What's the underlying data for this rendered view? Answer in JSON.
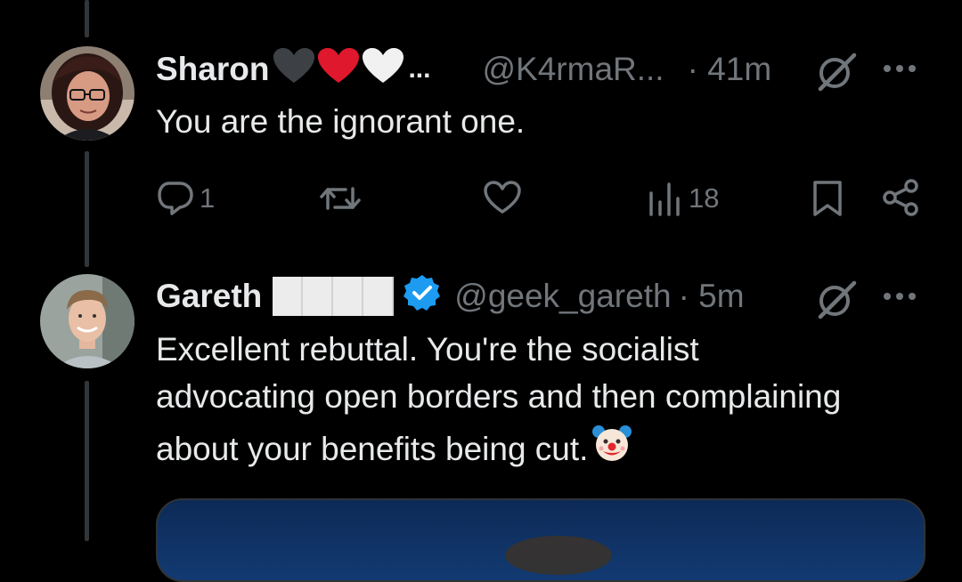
{
  "tweets": [
    {
      "display_name": "Sharon",
      "name_ellipsis": "...",
      "handle": "@K4rmaR...",
      "time": "· 41m",
      "text": "You are the ignorant one.",
      "reply_count": "1",
      "view_count": "18",
      "emoji_in_name": [
        "black-heart",
        "red-heart",
        "white-heart"
      ]
    },
    {
      "display_name": "Gareth",
      "handle": "@geek_gareth",
      "time": "· 5m",
      "text_lines": [
        "Excellent rebuttal. You're the socialist",
        "advocating open borders and then complaining",
        "about your benefits being cut."
      ],
      "verified": true,
      "trailing_emoji": "clown-face"
    }
  ],
  "colors": {
    "background": "#000000",
    "text": "#e7e9ea",
    "muted": "#71767b",
    "verified": "#1d9bf0",
    "heart_red": "#e0182d",
    "thread_line": "#333639"
  }
}
